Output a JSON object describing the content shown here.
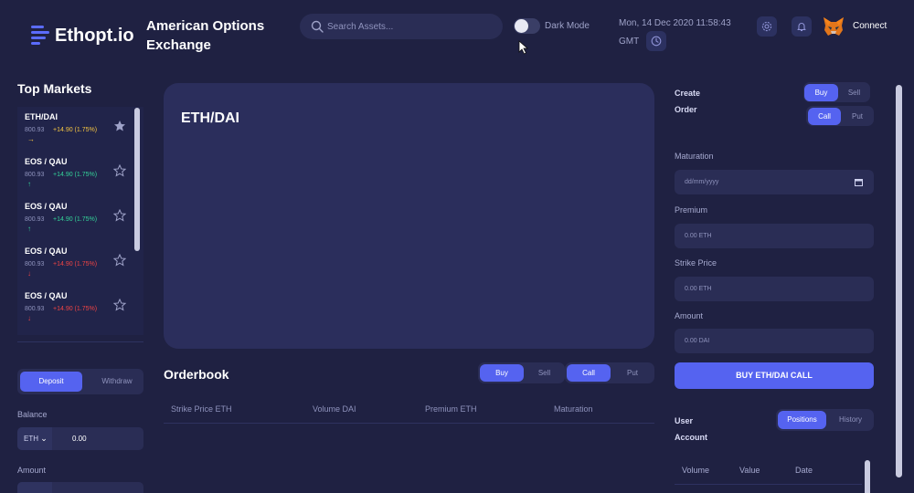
{
  "header": {
    "logo_text": "Ethopt.io",
    "app_title": "American Options Exchange",
    "search_placeholder": "Search Assets...",
    "dark_mode_label": "Dark Mode",
    "datetime": "Mon, 14 Dec 2020 11:58:43",
    "timezone": "GMT",
    "connect_label": "Connect"
  },
  "top_markets": {
    "title": "Top Markets",
    "items": [
      {
        "pair": "ETH/DAI",
        "price": "800.93",
        "change": "+14.90 (1.75%)",
        "trend": "right",
        "favorite": true
      },
      {
        "pair": "EOS / QAU",
        "price": "800.93",
        "change": "+14.90 (1.75%)",
        "trend": "up",
        "favorite": false
      },
      {
        "pair": "EOS / QAU",
        "price": "800.93",
        "change": "+14.90 (1.75%)",
        "trend": "up",
        "favorite": false
      },
      {
        "pair": "EOS / QAU",
        "price": "800.93",
        "change": "+14.90 (1.75%)",
        "trend": "down",
        "favorite": false
      },
      {
        "pair": "EOS / QAU",
        "price": "800.93",
        "change": "+14.90 (1.75%)",
        "trend": "down",
        "favorite": false
      }
    ]
  },
  "wallet": {
    "deposit_label": "Deposit",
    "withdraw_label": "Withdraw",
    "balance_label": "Balance",
    "balance_currency": "ETH",
    "balance_value": "0.00",
    "amount_label": "Amount"
  },
  "chart_panel": {
    "pair": "ETH/DAI"
  },
  "orderbook": {
    "title": "Orderbook",
    "buy_label": "Buy",
    "sell_label": "Sell",
    "call_label": "Call",
    "put_label": "Put",
    "columns": [
      "Strike Price ETH",
      "Volume DAI",
      "Premium ETH",
      "Maturation"
    ]
  },
  "create_order": {
    "title": "Create Order",
    "buy_label": "Buy",
    "sell_label": "Sell",
    "call_label": "Call",
    "put_label": "Put",
    "maturation_label": "Maturation",
    "maturation_placeholder": "dd/mm/yyyy",
    "premium_label": "Premium",
    "premium_placeholder": "0.00 ETH",
    "strike_label": "Strike Price",
    "strike_placeholder": "0.00 ETH",
    "amount_label": "Amount",
    "amount_placeholder": "0.00 DAI",
    "submit_label": "BUY ETH/DAI CALL"
  },
  "user_account": {
    "title": "User Account",
    "positions_label": "Positions",
    "history_label": "History",
    "columns": [
      "Volume",
      "Value",
      "Date"
    ]
  },
  "colors": {
    "background": "#1f2142",
    "panel": "#2b2e5c",
    "accent": "#5563f0",
    "positive": "#34d399",
    "negative": "#ef4444",
    "highlight": "#f5c542"
  }
}
